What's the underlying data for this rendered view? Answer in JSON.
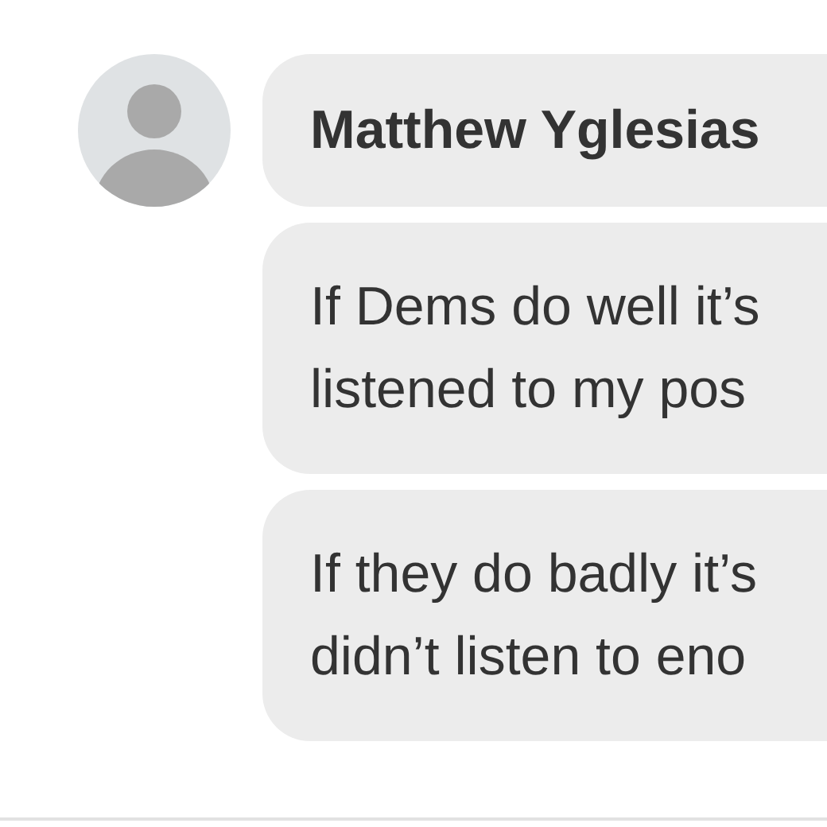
{
  "author": {
    "name": "Matthew Yglesias"
  },
  "messages": [
    {
      "lines": [
        "If Dems do well it’s",
        "listened to my pos"
      ]
    },
    {
      "lines": [
        "If they do badly it’s",
        "didn’t listen to eno"
      ]
    }
  ]
}
